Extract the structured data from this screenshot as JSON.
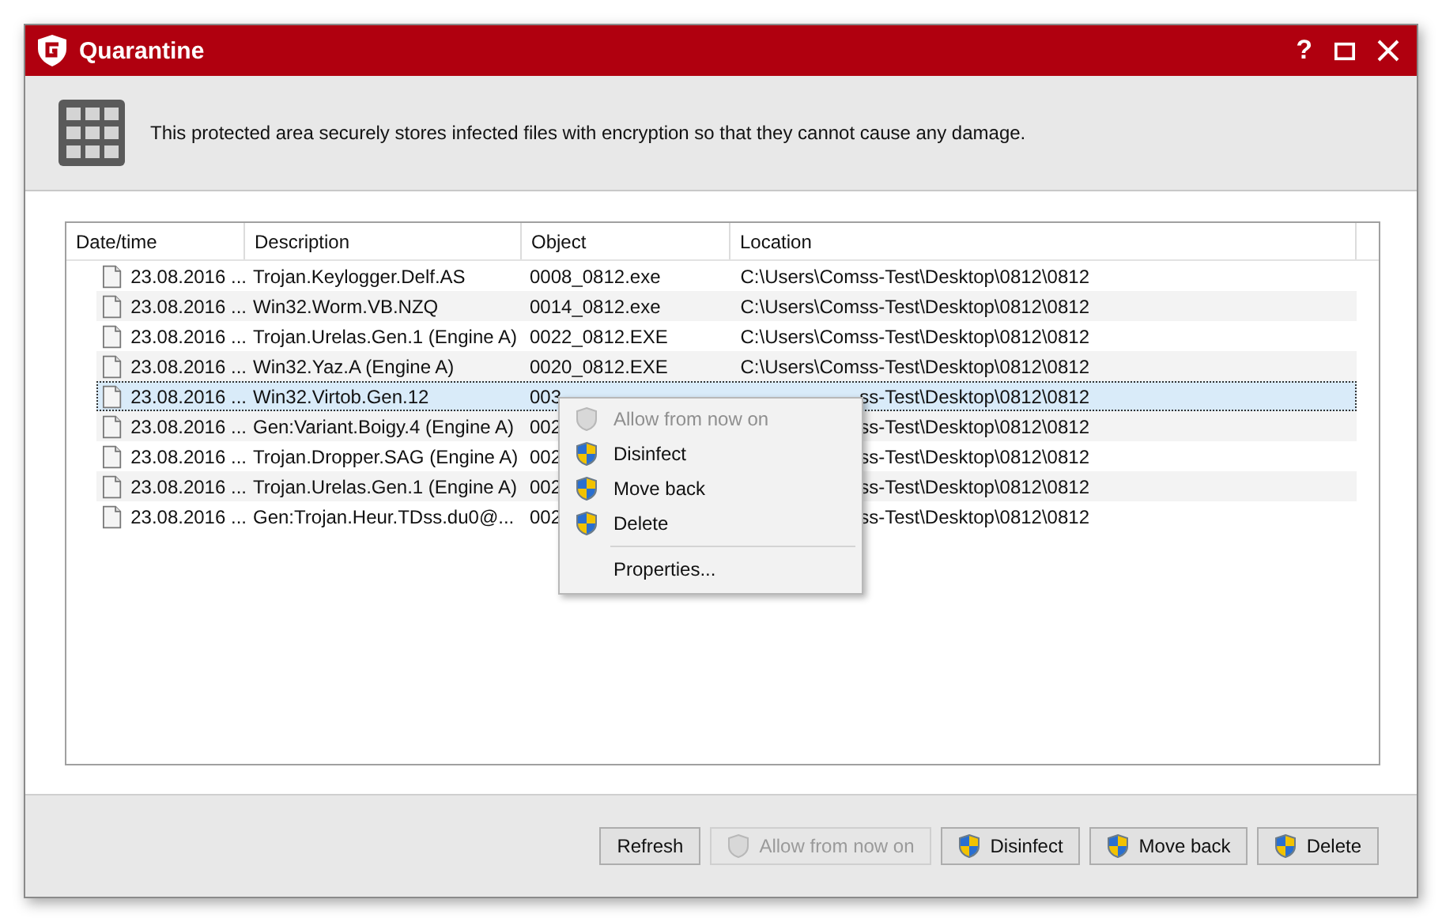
{
  "window": {
    "title": "Quarantine",
    "help_label": "?"
  },
  "header": {
    "text": "This protected area securely stores infected files with encryption so that they cannot cause any damage."
  },
  "table": {
    "columns": [
      "Date/time",
      "Description",
      "Object",
      "Location"
    ],
    "rows": [
      {
        "date": "23.08.2016 ...",
        "description": "Trojan.Keylogger.Delf.AS",
        "object": "0008_0812.exe",
        "location": "C:\\Users\\Comss-Test\\Desktop\\0812\\0812",
        "selected": false
      },
      {
        "date": "23.08.2016 ...",
        "description": "Win32.Worm.VB.NZQ",
        "object": "0014_0812.exe",
        "location": "C:\\Users\\Comss-Test\\Desktop\\0812\\0812",
        "selected": false
      },
      {
        "date": "23.08.2016 ...",
        "description": "Trojan.Urelas.Gen.1 (Engine A)",
        "object": "0022_0812.EXE",
        "location": "C:\\Users\\Comss-Test\\Desktop\\0812\\0812",
        "selected": false
      },
      {
        "date": "23.08.2016 ...",
        "description": "Win32.Yaz.A (Engine A)",
        "object": "0020_0812.EXE",
        "location": "C:\\Users\\Comss-Test\\Desktop\\0812\\0812",
        "selected": false
      },
      {
        "date": "23.08.2016 ...",
        "description": "Win32.Virtob.Gen.12",
        "object": "003",
        "location": "ss-Test\\Desktop\\0812\\0812",
        "selected": true
      },
      {
        "date": "23.08.2016 ...",
        "description": "Gen:Variant.Boigy.4 (Engine A)",
        "object": "002",
        "location": "ss-Test\\Desktop\\0812\\0812",
        "selected": false
      },
      {
        "date": "23.08.2016 ...",
        "description": "Trojan.Dropper.SAG (Engine A)",
        "object": "002",
        "location": "ss-Test\\Desktop\\0812\\0812",
        "selected": false
      },
      {
        "date": "23.08.2016 ...",
        "description": "Trojan.Urelas.Gen.1 (Engine A)",
        "object": "002",
        "location": "ss-Test\\Desktop\\0812\\0812",
        "selected": false
      },
      {
        "date": "23.08.2016 ...",
        "description": "Gen:Trojan.Heur.TDss.du0@...",
        "object": "002",
        "location": "ss-Test\\Desktop\\0812\\0812",
        "selected": false
      }
    ]
  },
  "context_menu": {
    "items": [
      {
        "kind": "item",
        "label": "Allow from now on",
        "disabled": true,
        "shield": true
      },
      {
        "kind": "item",
        "label": "Disinfect",
        "disabled": false,
        "shield": true
      },
      {
        "kind": "item",
        "label": "Move back",
        "disabled": false,
        "shield": true
      },
      {
        "kind": "item",
        "label": "Delete",
        "disabled": false,
        "shield": true
      },
      {
        "kind": "separator"
      },
      {
        "kind": "item",
        "label": "Properties...",
        "disabled": false,
        "shield": false
      }
    ]
  },
  "buttons": [
    {
      "label": "Refresh",
      "disabled": false,
      "shield": false
    },
    {
      "label": "Allow from now on",
      "disabled": true,
      "shield": true
    },
    {
      "label": "Disinfect",
      "disabled": false,
      "shield": true
    },
    {
      "label": "Move back",
      "disabled": false,
      "shield": true
    },
    {
      "label": "Delete",
      "disabled": false,
      "shield": true
    }
  ]
}
